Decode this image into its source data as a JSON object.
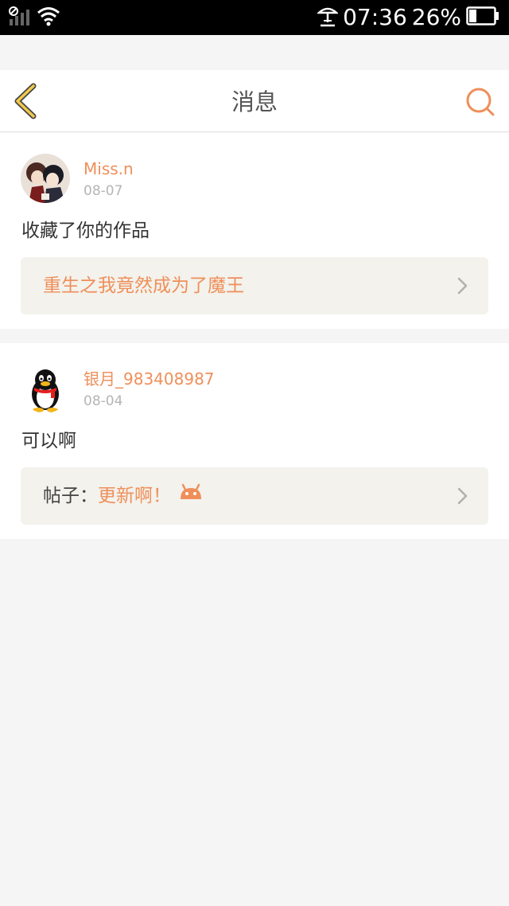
{
  "status_bar": {
    "time": "07:36",
    "battery": "26%"
  },
  "header": {
    "title": "消息"
  },
  "messages": [
    {
      "username": "Miss.n",
      "date": "08-07",
      "text": "收藏了你的作品",
      "link": {
        "title": "重生之我竟然成为了魔王"
      }
    },
    {
      "username": "银月_983408987",
      "date": "08-04",
      "text": "可以啊",
      "link": {
        "prefix": "帖子：",
        "title": "更新啊！"
      }
    }
  ],
  "colors": {
    "accent": "#ef8f5a",
    "background": "#f5f5f5",
    "link_box": "#f3f2ec"
  }
}
